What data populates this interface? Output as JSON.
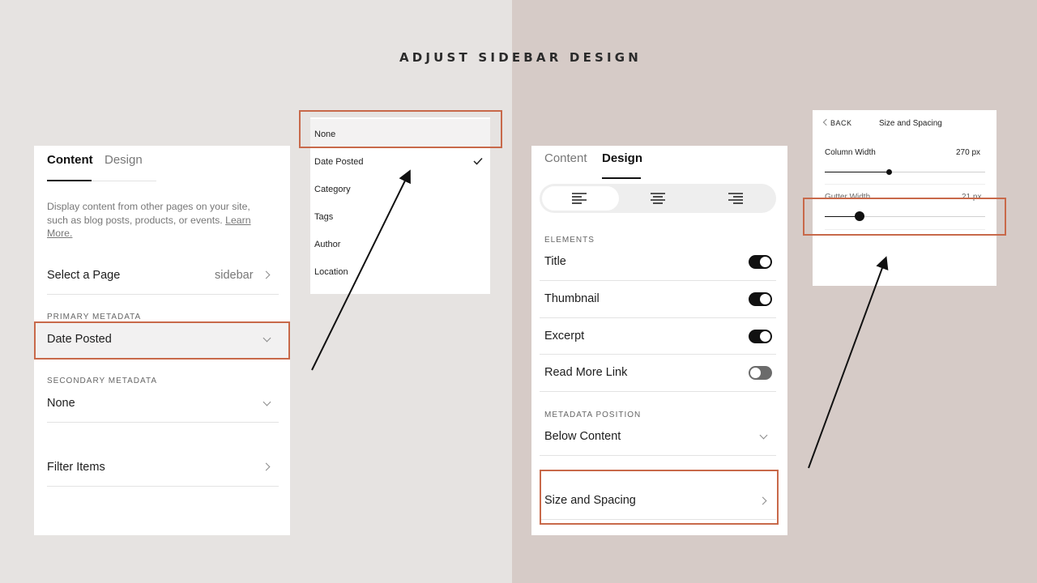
{
  "heading": "ADJUST SIDEBAR DESIGN",
  "accent_color": "#c8694a",
  "content_panel": {
    "tabs": [
      {
        "label": "Content",
        "active": true
      },
      {
        "label": "Design",
        "active": false
      }
    ],
    "description_line1": "Display content from other pages on your site,",
    "description_line2": "such as blog posts, products, or events.",
    "learn_more_1": "Learn",
    "learn_more_2": "More.",
    "select_page_label": "Select a Page",
    "select_page_value": "sidebar",
    "primary_metadata_label": "PRIMARY METADATA",
    "primary_metadata_value": "Date Posted",
    "secondary_metadata_label": "SECONDARY METADATA",
    "secondary_metadata_value": "None",
    "filter_items_label": "Filter Items"
  },
  "dropdown": {
    "options": [
      "None",
      "Date Posted",
      "Category",
      "Tags",
      "Author",
      "Location"
    ],
    "checked": "Date Posted",
    "highlighted": "None"
  },
  "design_panel": {
    "tabs": [
      {
        "label": "Content",
        "active": false
      },
      {
        "label": "Design",
        "active": true
      }
    ],
    "alignment_options": [
      "align-left-icon",
      "align-center-icon",
      "align-right-icon"
    ],
    "alignment_selected": "align-left-icon",
    "elements_label": "ELEMENTS",
    "toggles": [
      {
        "label": "Title",
        "on": true
      },
      {
        "label": "Thumbnail",
        "on": true
      },
      {
        "label": "Excerpt",
        "on": true
      },
      {
        "label": "Read More Link",
        "on": false
      }
    ],
    "metadata_position_label": "METADATA POSITION",
    "metadata_position_value": "Below Content",
    "size_spacing_label": "Size and Spacing"
  },
  "size_panel": {
    "back_label": "BACK",
    "title": "Size and Spacing",
    "column_width_label": "Column Width",
    "column_width_value": "270 px",
    "column_width_level": 0.4,
    "gutter_width_label": "Gutter Width",
    "gutter_width_value": "21 px",
    "gutter_width_level": 0.21
  }
}
